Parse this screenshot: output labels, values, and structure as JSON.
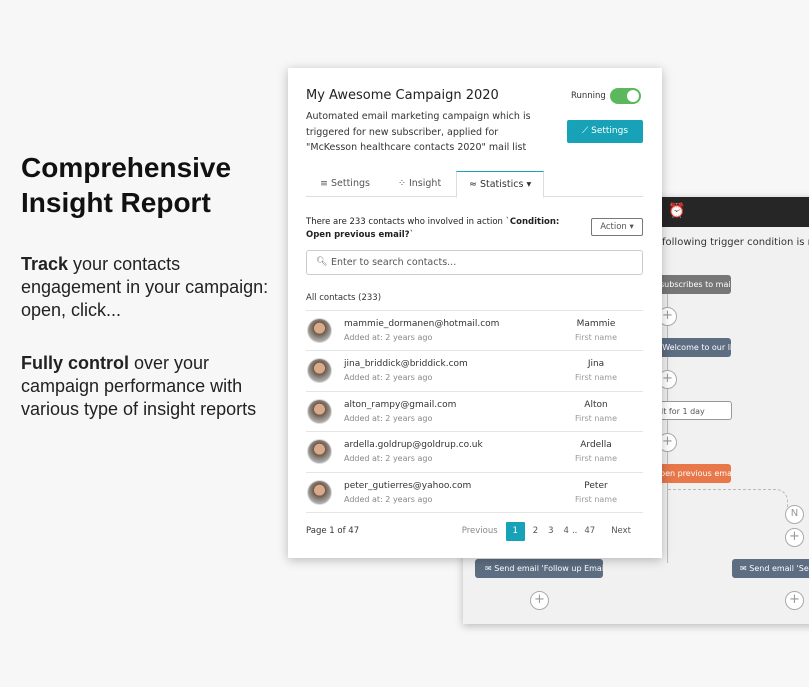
{
  "promo": {
    "heading": "Comprehensive Insight Report",
    "p1_bold": "Track",
    "p1_rest": " your contacts engagement in your campaign: open, click...",
    "p2_bold": "Fully control",
    "p2_rest": " over your campaign performance with various type of insight reports"
  },
  "background_flow": {
    "header_icon": "alarm-clock-icon",
    "trigger_text": "following trigger condition is met",
    "nodes": [
      "subscribes to mail list",
      "'Welcome to our list'",
      "it for 1 day",
      "pen previous email?",
      "Send email 'Follow up Email'",
      "Send email 'Send F"
    ],
    "branch_label": "N",
    "plus": "+",
    "colors": {
      "grey": "#777777",
      "slate": "#5d6d82",
      "orange": "#e8774a"
    }
  },
  "campaign": {
    "title": "My Awesome Campaign 2020",
    "description": "Automated email marketing campaign which is triggered for new subscriber, applied for \"McKesson healthcare contacts 2020\" mail list",
    "status_label": "Running",
    "running": true,
    "settings_button": "Settings",
    "accent": "#17a2b8"
  },
  "tabs": [
    {
      "label": "Settings",
      "icon": "list-icon",
      "active": false
    },
    {
      "label": "Insight",
      "icon": "insight-icon",
      "active": false
    },
    {
      "label": "Statistics",
      "icon": "statistics-icon",
      "active": true
    }
  ],
  "stats": {
    "info_prefix": "There are 233 contacts who involved in action `",
    "info_bold": "Condition: Open previous email?",
    "info_suffix": "`",
    "action_button": "Action",
    "search_placeholder": "Enter to search contacts...",
    "all_contacts": "All contacts (233)"
  },
  "contacts": [
    {
      "email": "mammie_dormanen@hotmail.com",
      "added": "Added at: 2 years ago",
      "name": "Mammie",
      "field": "First name"
    },
    {
      "email": "jina_briddick@briddick.com",
      "added": "Added at: 2 years ago",
      "name": "Jina",
      "field": "First name"
    },
    {
      "email": "alton_rampy@gmail.com",
      "added": "Added at: 2 years ago",
      "name": "Alton",
      "field": "First name"
    },
    {
      "email": "ardella.goldrup@goldrup.co.uk",
      "added": "Added at: 2 years ago",
      "name": "Ardella",
      "field": "First name"
    },
    {
      "email": "peter_gutierres@yahoo.com",
      "added": "Added at: 2 years ago",
      "name": "Peter",
      "field": "First name"
    }
  ],
  "pagination": {
    "info": "Page 1 of 47",
    "previous": "Previous",
    "pages": [
      "1",
      "2",
      "3",
      "4"
    ],
    "ellipsis": "..",
    "last": "47",
    "next": "Next",
    "current": "1"
  }
}
